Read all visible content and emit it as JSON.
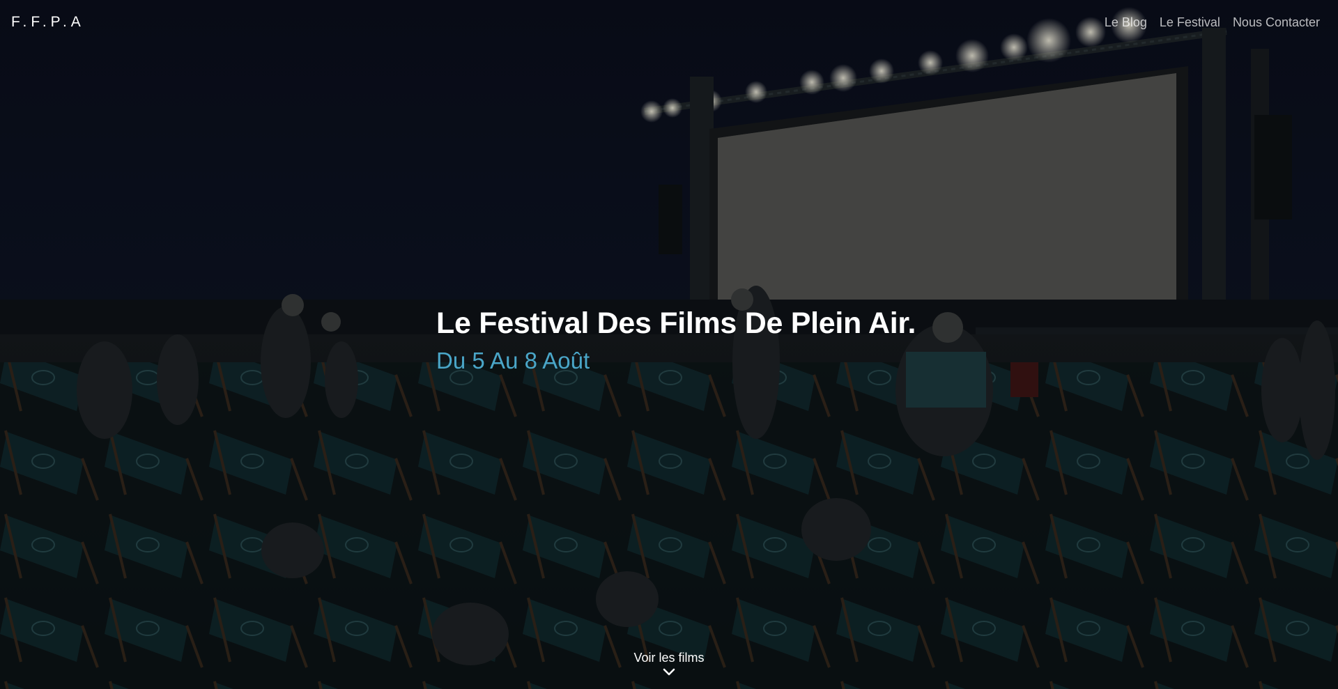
{
  "brand": {
    "logo_text": "F.F.P.A"
  },
  "nav": {
    "links": [
      {
        "label": "Le Blog"
      },
      {
        "label": "Le Festival"
      },
      {
        "label": "Nous Contacter"
      }
    ]
  },
  "hero": {
    "title": "Le Festival Des Films De Plein Air.",
    "subtitle": "Du 5 Au 8 Août"
  },
  "cta": {
    "label": "Voir les films",
    "icon": "chevron-down-icon"
  },
  "colors": {
    "accent": "#4aa6c8",
    "text": "#ffffff",
    "background": "#05070c"
  }
}
